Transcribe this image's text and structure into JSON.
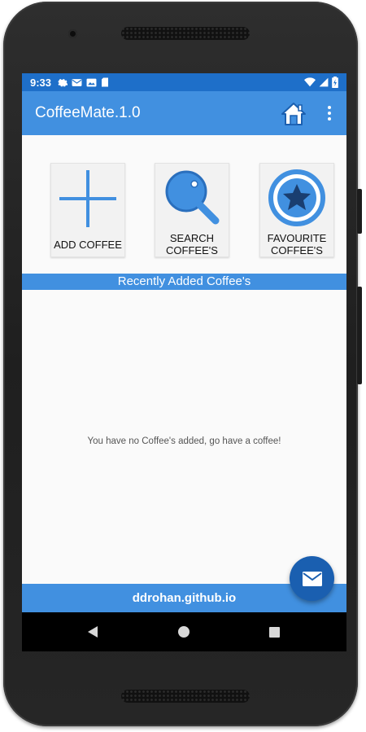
{
  "status_bar": {
    "time": "9:33",
    "left_icons": [
      "settings-icon",
      "mail-icon",
      "photo-icon",
      "sd-card-icon"
    ],
    "right_icons": [
      "wifi-icon",
      "signal-icon",
      "battery-icon"
    ]
  },
  "app_bar": {
    "title": "CoffeeMate.1.0",
    "actions": [
      "home-icon",
      "more-vert-icon"
    ]
  },
  "tiles": [
    {
      "label": "ADD COFFEE",
      "icon": "plus-icon"
    },
    {
      "label_line1": "SEARCH",
      "label_line2": "COFFEE'S",
      "icon": "search-icon"
    },
    {
      "label_line1": "FAVOURITE",
      "label_line2": "COFFEE'S",
      "icon": "star-icon"
    }
  ],
  "section_header": "Recently Added Coffee's",
  "empty_message": "You have no Coffee's added, go have a coffee!",
  "footer_text": "ddrohan.github.io",
  "fab": {
    "icon": "email-icon"
  },
  "nav_bar": {
    "buttons": [
      "back-icon",
      "home-circle-icon",
      "recents-icon"
    ]
  },
  "colors": {
    "primary": "#4190e0",
    "primary_dark": "#1e6fc9",
    "fab": "#1a5fb0",
    "background": "#fafafa"
  }
}
